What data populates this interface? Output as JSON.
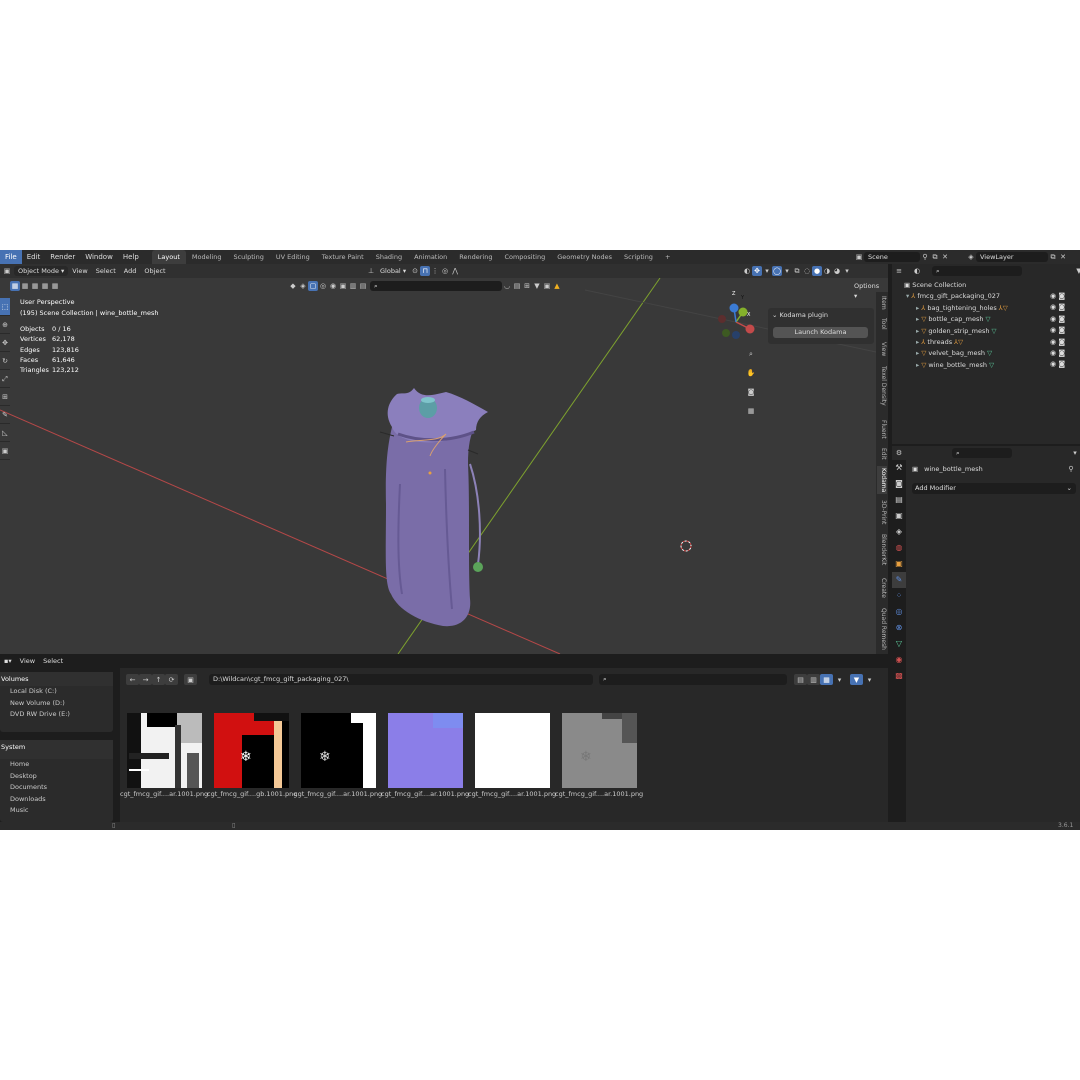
{
  "menubar": {
    "menus": [
      "File",
      "Edit",
      "Render",
      "Window",
      "Help"
    ],
    "workspaces": [
      "Layout",
      "Modeling",
      "Sculpting",
      "UV Editing",
      "Texture Paint",
      "Shading",
      "Animation",
      "Rendering",
      "Compositing",
      "Geometry Nodes",
      "Scripting"
    ],
    "add_tab": "+",
    "scene": "Scene",
    "view_layer": "ViewLayer"
  },
  "viewport": {
    "mode": "Object Mode",
    "menus": [
      "View",
      "Select",
      "Add",
      "Object"
    ],
    "orientation": "Global",
    "options": "Options",
    "title": "User Perspective",
    "subtitle": "(195) Scene Collection | wine_bottle_mesh",
    "stats": [
      {
        "label": "Objects",
        "value": "0 / 16"
      },
      {
        "label": "Vertices",
        "value": "62,178"
      },
      {
        "label": "Edges",
        "value": "123,816"
      },
      {
        "label": "Faces",
        "value": "61,646"
      },
      {
        "label": "Triangles",
        "value": "123,212"
      }
    ],
    "kodama": {
      "title": "Kodama plugin",
      "button": "Launch Kodama"
    },
    "side_tabs": [
      "Item",
      "Tool",
      "View",
      "Texel Density",
      "Fluent",
      "Edit",
      "Kodama",
      "3D-Print",
      "BlenderKit",
      "Create",
      "Quad Remesh"
    ],
    "gizmo": {
      "x": "X",
      "y": "Y",
      "z": "Z"
    },
    "colors": {
      "bg": "#393939",
      "mesh": "#7b6fb0",
      "x_axis": "#c34a4a",
      "y_axis": "#84b02b"
    }
  },
  "file_browser": {
    "menus": [
      "View",
      "Select"
    ],
    "path": "D:\\Wildcan\\cgt_fmcg_gift_packaging_027\\",
    "volumes_title": "Volumes",
    "volumes": [
      "Local Disk (C:)",
      "New Volume (D:)",
      "DVD RW Drive (E:)"
    ],
    "system_title": "System",
    "system": [
      "Home",
      "Desktop",
      "Documents",
      "Downloads",
      "Music"
    ],
    "files": [
      {
        "name": "cgt_fmcg_gif....ar.1001.png",
        "kind": "ao"
      },
      {
        "name": "cgt_fmcg_gif....gb.1001.png",
        "kind": "rgb"
      },
      {
        "name": "cgt_fmcg_gif....ar.1001.png",
        "kind": "mask"
      },
      {
        "name": "cgt_fmcg_gif....ar.1001.png",
        "kind": "normal"
      },
      {
        "name": "cgt_fmcg_gif....ar.1001.png",
        "kind": "white"
      },
      {
        "name": "cgt_fmcg_gif....ar.1001.png",
        "kind": "gray"
      }
    ]
  },
  "outliner": {
    "root": "Scene Collection",
    "collection": "fmcg_gift_packaging_027",
    "items": [
      {
        "name": "bag_tightening_holes",
        "type": "curve"
      },
      {
        "name": "bottle_cap_mesh",
        "type": "mesh"
      },
      {
        "name": "golden_strip_mesh",
        "type": "mesh"
      },
      {
        "name": "threads",
        "type": "curve"
      },
      {
        "name": "velvet_bag_mesh",
        "type": "mesh"
      },
      {
        "name": "wine_bottle_mesh",
        "type": "mesh"
      }
    ]
  },
  "properties": {
    "object": "wine_bottle_mesh",
    "add_modifier": "Add Modifier"
  },
  "status": {
    "version": "3.6.1"
  }
}
